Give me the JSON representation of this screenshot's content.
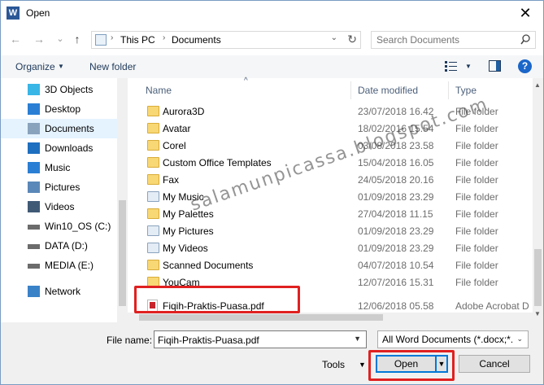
{
  "window": {
    "title": "Open",
    "app_icon": "W",
    "close_glyph": "✕"
  },
  "nav": {
    "back": "←",
    "forward": "→",
    "recent": "⌄",
    "up": "↑"
  },
  "address": {
    "crumbs": [
      "This PC",
      "Documents"
    ],
    "separator": "›",
    "dropdown": "⌄",
    "refresh": "↻"
  },
  "search": {
    "placeholder": "Search Documents"
  },
  "toolbar": {
    "organize": "Organize",
    "organize_arrow": "▼",
    "new_folder": "New folder",
    "view_arrow": "▼",
    "help": "?"
  },
  "sidebar": {
    "items": [
      {
        "label": "3D Objects",
        "icon": "3d-objects-icon",
        "selected": false
      },
      {
        "label": "Desktop",
        "icon": "desktop-icon",
        "selected": false
      },
      {
        "label": "Documents",
        "icon": "documents-icon",
        "selected": true
      },
      {
        "label": "Downloads",
        "icon": "downloads-icon",
        "selected": false
      },
      {
        "label": "Music",
        "icon": "music-icon",
        "selected": false
      },
      {
        "label": "Pictures",
        "icon": "pictures-icon",
        "selected": false
      },
      {
        "label": "Videos",
        "icon": "videos-icon",
        "selected": false
      },
      {
        "label": "Win10_OS (C:)",
        "icon": "drive-icon",
        "selected": false
      },
      {
        "label": "DATA (D:)",
        "icon": "drive-icon",
        "selected": false
      },
      {
        "label": "MEDIA (E:)",
        "icon": "drive-icon",
        "selected": false
      },
      {
        "label": "Network",
        "icon": "network-icon",
        "selected": false
      }
    ]
  },
  "columns": {
    "name": "Name",
    "date": "Date modified",
    "type": "Type",
    "sort_glyph": "^"
  },
  "files": [
    {
      "name": "Aurora3D",
      "date": "23/07/2018 16.42",
      "type": "File folder",
      "icon": "folder-icon"
    },
    {
      "name": "Avatar",
      "date": "18/02/2016 15.54",
      "type": "File folder",
      "icon": "folder-icon"
    },
    {
      "name": "Corel",
      "date": "03/08/2018 23.58",
      "type": "File folder",
      "icon": "folder-icon"
    },
    {
      "name": "Custom Office Templates",
      "date": "15/04/2018 16.05",
      "type": "File folder",
      "icon": "folder-icon"
    },
    {
      "name": "Fax",
      "date": "24/05/2018 20.16",
      "type": "File folder",
      "icon": "folder-icon"
    },
    {
      "name": "My Music",
      "date": "01/09/2018 23.29",
      "type": "File folder",
      "icon": "music-folder-icon"
    },
    {
      "name": "My Palettes",
      "date": "27/04/2018 11.15",
      "type": "File folder",
      "icon": "folder-icon"
    },
    {
      "name": "My Pictures",
      "date": "01/09/2018 23.29",
      "type": "File folder",
      "icon": "pictures-folder-icon"
    },
    {
      "name": "My Videos",
      "date": "01/09/2018 23.29",
      "type": "File folder",
      "icon": "videos-folder-icon"
    },
    {
      "name": "Scanned Documents",
      "date": "04/07/2018 10.54",
      "type": "File folder",
      "icon": "folder-icon"
    },
    {
      "name": "YouCam",
      "date": "12/07/2016 15.31",
      "type": "File folder",
      "icon": "folder-icon"
    },
    {
      "name": "Fiqih-Praktis-Puasa.pdf",
      "date": "12/06/2018 05.58",
      "type": "Adobe Acrobat D",
      "icon": "pdf-icon"
    }
  ],
  "watermark": "salamunpicassa.blogspot.com",
  "bottom": {
    "file_name_label": "File name:",
    "file_name_value": "Fiqih-Praktis-Puasa.pdf",
    "file_type": "All Word Documents (*.docx;*.d",
    "tools": "Tools",
    "tools_arrow": "▼",
    "open": "Open",
    "open_arrow": "▼",
    "cancel": "Cancel"
  },
  "colors": {
    "selection": "#e5f3ff",
    "highlight": "#e02020",
    "accent": "#0078d7",
    "folder": "#f8d775"
  }
}
